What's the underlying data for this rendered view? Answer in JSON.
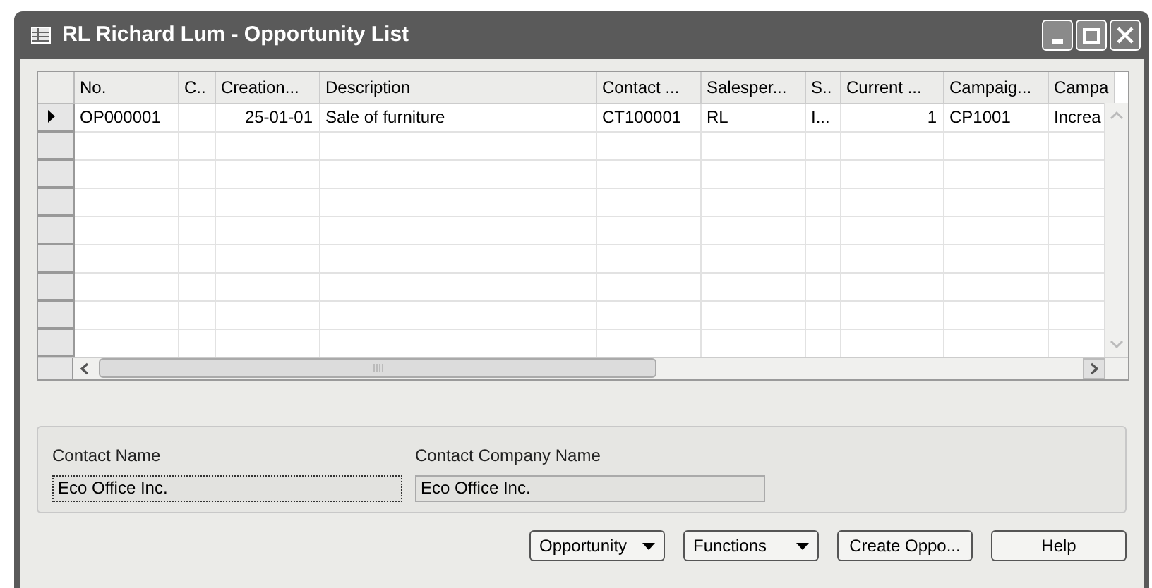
{
  "window": {
    "title": "RL Richard Lum - Opportunity List"
  },
  "table": {
    "columns": [
      {
        "label": "No.",
        "kind": "text"
      },
      {
        "label": "C..",
        "kind": "text"
      },
      {
        "label": "Creation...",
        "kind": "date"
      },
      {
        "label": "Description",
        "kind": "text"
      },
      {
        "label": "Contact ...",
        "kind": "text"
      },
      {
        "label": "Salesper...",
        "kind": "text"
      },
      {
        "label": "S..",
        "kind": "text"
      },
      {
        "label": "Current ...",
        "kind": "number"
      },
      {
        "label": "Campaig...",
        "kind": "text"
      },
      {
        "label": "Campa",
        "kind": "text"
      }
    ],
    "rows": [
      {
        "current": true,
        "cells": [
          "OP000001",
          "",
          "25-01-01",
          "Sale of furniture",
          "CT100001",
          "RL",
          "I...",
          "1",
          "CP1001",
          "Increa"
        ]
      }
    ]
  },
  "details": [
    {
      "label": "Contact Name",
      "value": "Eco Office Inc.",
      "focused": true
    },
    {
      "label": "Contact Company Name",
      "value": "Eco Office Inc.",
      "focused": false
    }
  ],
  "buttons": [
    {
      "kind": "menu",
      "label": "Opportunity"
    },
    {
      "kind": "menu",
      "label": "Functions"
    },
    {
      "kind": "plain",
      "label": "Create Oppo..."
    },
    {
      "kind": "plain",
      "label": "Help"
    }
  ]
}
